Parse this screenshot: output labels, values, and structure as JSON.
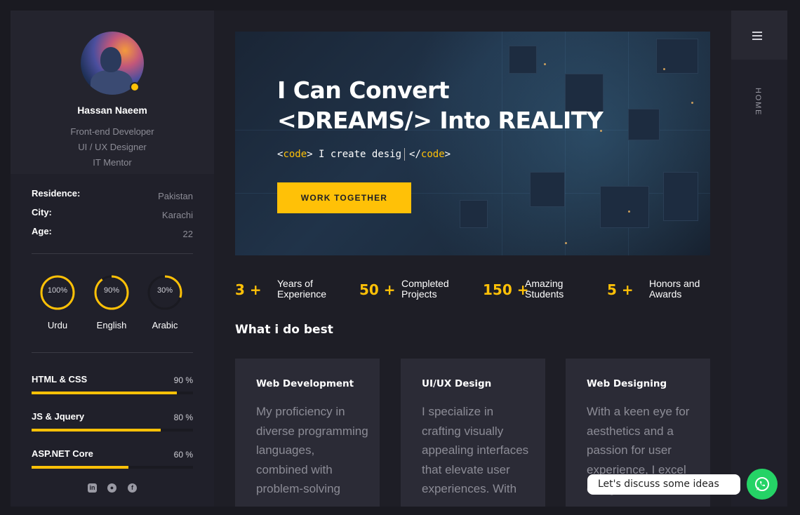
{
  "profile": {
    "name": "Hassan Naeem",
    "roles": [
      "Front-end Developer",
      "UI / UX Designer",
      "IT Mentor"
    ]
  },
  "info": [
    {
      "key": "Residence:",
      "value": "Pakistan"
    },
    {
      "key": "City:",
      "value": "Karachi"
    },
    {
      "key": "Age:",
      "value": "22"
    }
  ],
  "languages": [
    {
      "label": "Urdu",
      "percent_text": "100%",
      "percent": 100
    },
    {
      "label": "English",
      "percent_text": "90%",
      "percent": 90
    },
    {
      "label": "Arabic",
      "percent_text": "30%",
      "percent": 30
    }
  ],
  "skills": [
    {
      "label": "HTML & CSS",
      "percent_text": "90 %",
      "percent": 90
    },
    {
      "label": "JS & Jquery",
      "percent_text": "80 %",
      "percent": 80
    },
    {
      "label": "ASP.NET Core",
      "percent_text": "60 %",
      "percent": 60
    }
  ],
  "social": {
    "icons": [
      "linkedin-icon",
      "github-icon",
      "facebook-icon"
    ]
  },
  "hero": {
    "title_line1": "I Can Convert",
    "title_line2": "<DREAMS/> Into REALITY",
    "code_open": "<code>",
    "typed": "I create desig",
    "code_close": "</code>",
    "button_label": "WORK TOGETHER"
  },
  "stats": [
    {
      "number": "3 +",
      "line1": "Years of",
      "line2": "Experience"
    },
    {
      "number": "50 +",
      "line1": "Completed",
      "line2": "Projects"
    },
    {
      "number": "150 +",
      "line1": "Amazing",
      "line2": "Students"
    },
    {
      "number": "5 +",
      "line1": "Honors and",
      "line2": "Awards"
    }
  ],
  "services": {
    "title": "What i do best",
    "cards": [
      {
        "title": "Web Development",
        "text": "My proficiency in diverse programming languages, combined with problem-solving"
      },
      {
        "title": "UI/UX Design",
        "text": "I specialize in crafting visually appealing interfaces that elevate user experiences. With"
      },
      {
        "title": "Web Designing",
        "text": "With a keen eye for aesthetics and a passion for user experience, I excel designer"
      }
    ]
  },
  "nav": {
    "current": "HOME"
  },
  "chat": {
    "prompt": "Let's discuss some ideas"
  },
  "colors": {
    "accent": "#ffc107",
    "background": "#1e1e26",
    "whatsapp": "#25d366"
  }
}
